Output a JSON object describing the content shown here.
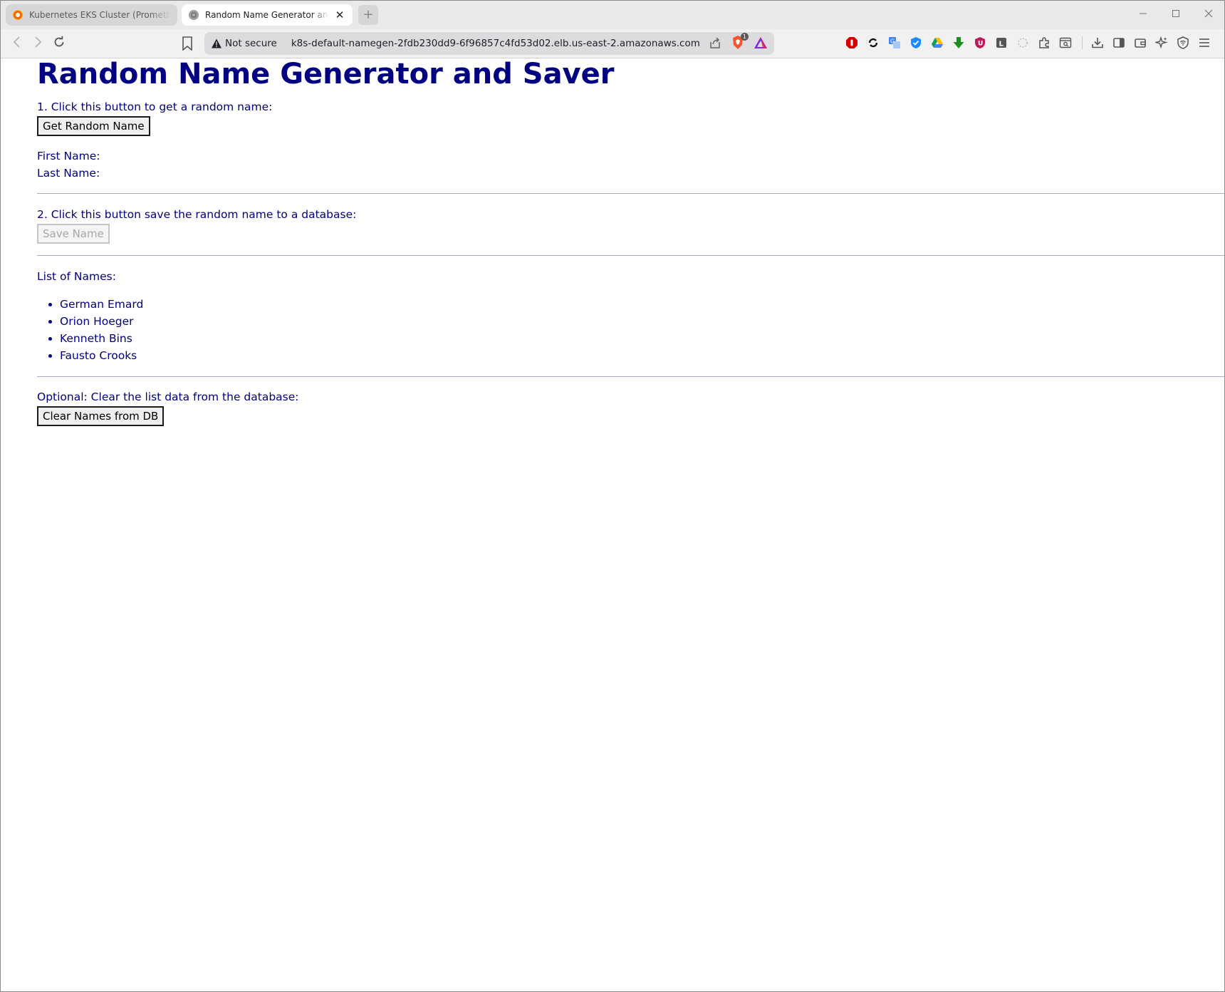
{
  "browser": {
    "tabs": [
      {
        "title": "Kubernetes EKS Cluster (Prometheus)",
        "favicon": "grafana-icon",
        "active": false
      },
      {
        "title": "Random Name Generator and Saver",
        "favicon": "globe-icon",
        "active": true
      }
    ],
    "address_bar": {
      "security_label": "Not secure",
      "url": "k8s-default-namegen-2fdb230dd9-6f96857c4fd53d02.elb.us-east-2.amazonaws.com"
    },
    "brave_shield_count": "1"
  },
  "page": {
    "title": "Random Name Generator and Saver",
    "step1_label": "1. Click this button to get a random name:",
    "get_random_button": "Get Random Name",
    "first_name_label": "First Name:",
    "last_name_label": "Last Name:",
    "step2_label": "2. Click this button save the random name to a database:",
    "save_button": "Save Name",
    "save_button_disabled": true,
    "list_label": "List of Names:",
    "names": [
      "German Emard",
      "Orion Hoeger",
      "Kenneth Bins",
      "Fausto Crooks"
    ],
    "clear_label": "Optional: Clear the list data from the database:",
    "clear_button": "Clear Names from DB"
  },
  "colors": {
    "text": "#000080",
    "tabstrip": "#e9e9ea",
    "toolbar": "#f1f1f2"
  }
}
